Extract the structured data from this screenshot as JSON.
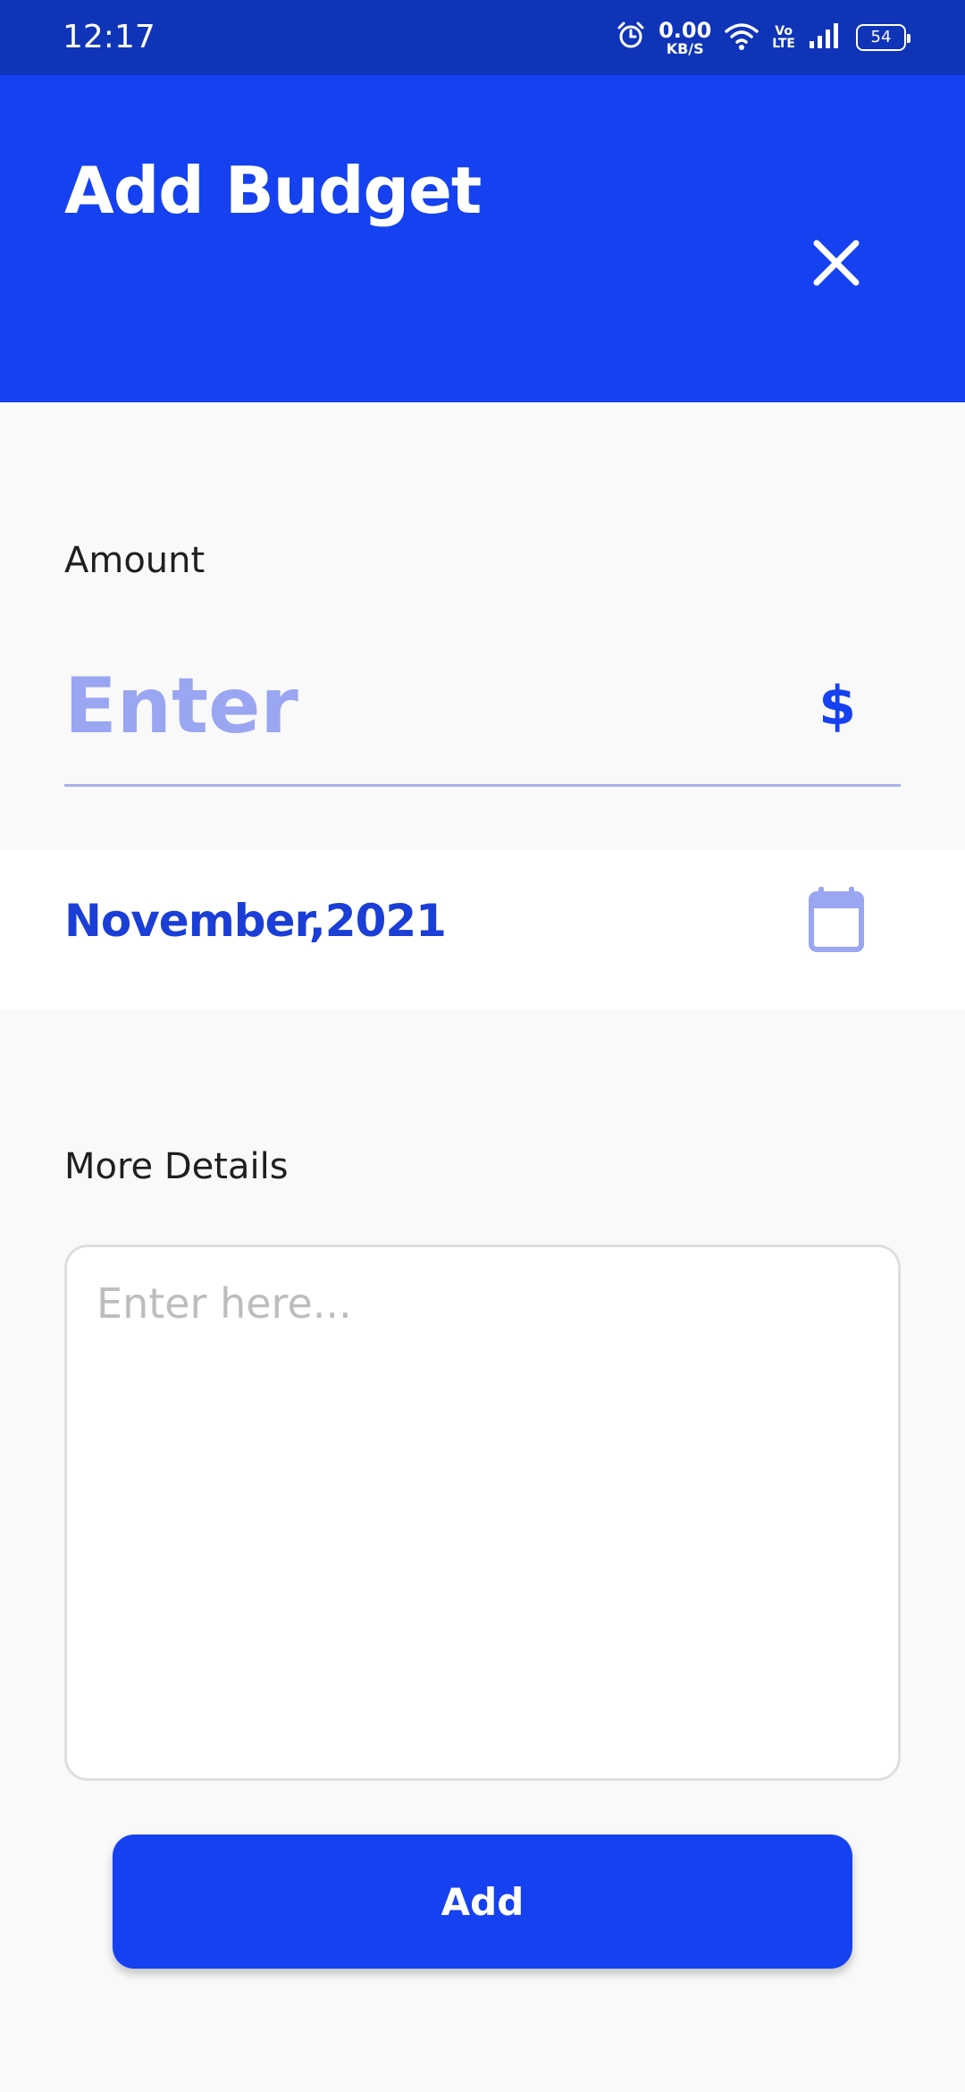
{
  "status_bar": {
    "time": "12:17",
    "net_speed_value": "0.00",
    "net_speed_unit": "KB/S",
    "volte_top": "Vo",
    "volte_bottom": "LTE",
    "battery": "54"
  },
  "header": {
    "title": "Add Budget",
    "close_icon": "close-icon"
  },
  "amount": {
    "label": "Amount",
    "placeholder": "Enter",
    "currency_symbol": "$"
  },
  "date": {
    "value": "November,2021",
    "icon": "calendar-icon"
  },
  "details": {
    "label": "More Details",
    "placeholder": "Enter here..."
  },
  "actions": {
    "add_label": "Add"
  },
  "colors": {
    "status_bar": "#1034b8",
    "header": "#1541f0",
    "accent": "#1541f0",
    "placeholder_accent": "#9aa6f1",
    "background": "#f9f9f9"
  }
}
